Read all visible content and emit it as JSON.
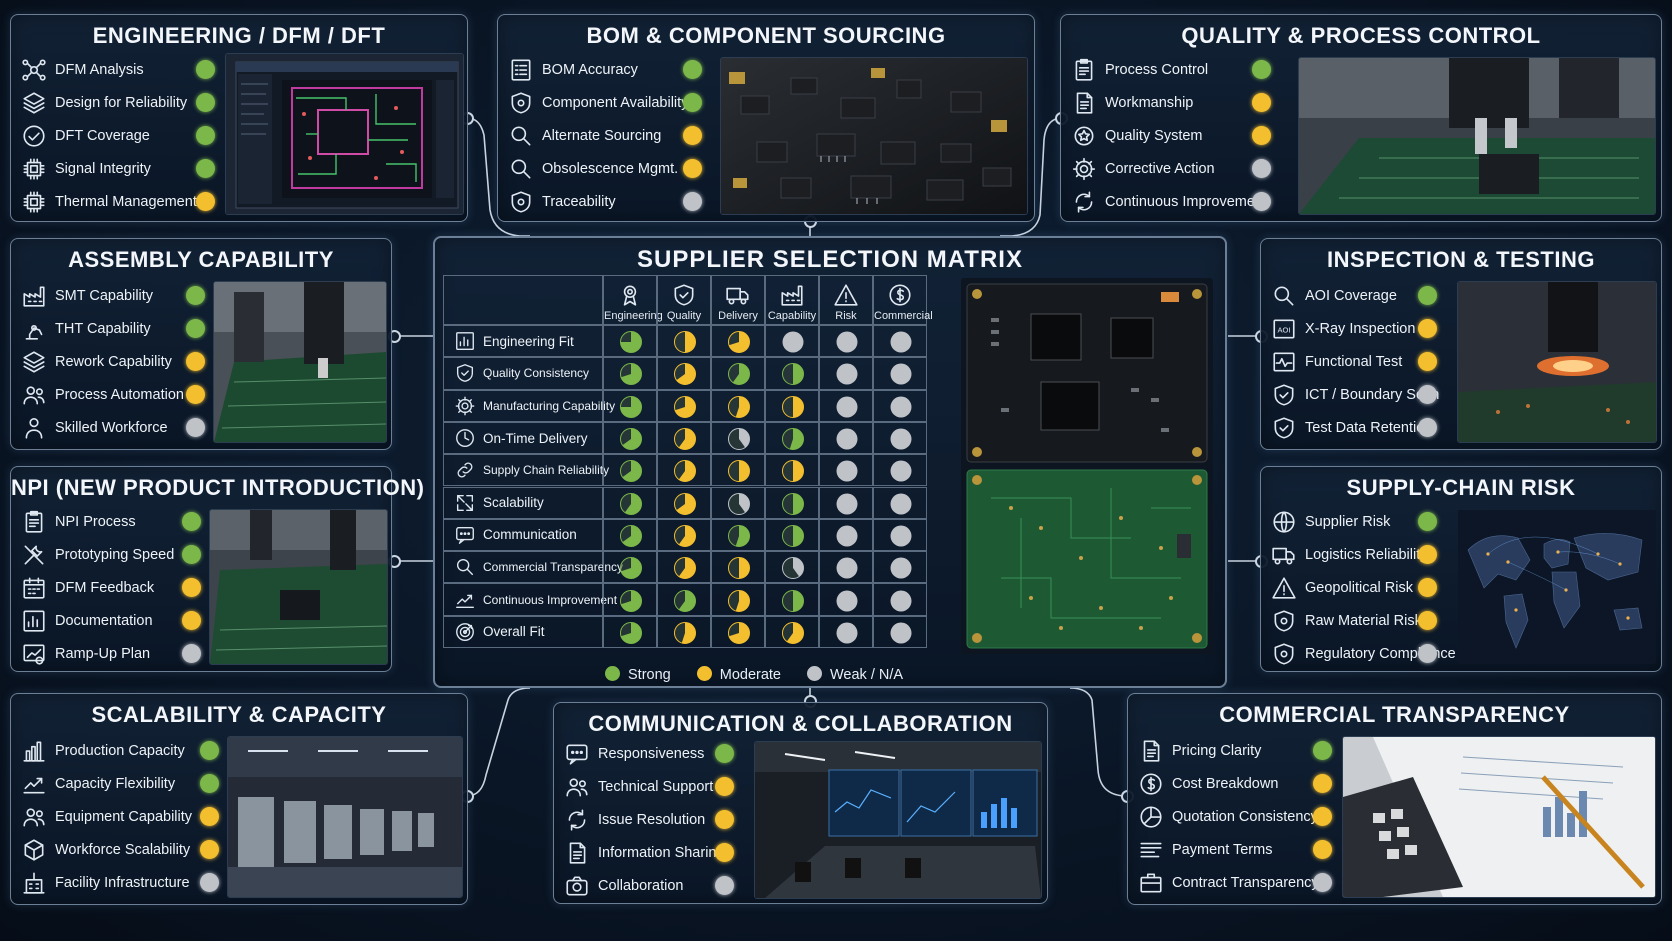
{
  "colors": {
    "strong": "#7cb74a",
    "moderate": "#f3bf2e",
    "weak": "#bfc3c8",
    "accent": "#8fd0ff"
  },
  "panels": {
    "engineering": {
      "title": "ENGINEERING / DFM / DFT",
      "items": [
        {
          "label": "DFM Analysis",
          "icon": "network-icon",
          "status": "strong"
        },
        {
          "label": "Design for Reliability",
          "icon": "layers-icon",
          "status": "strong"
        },
        {
          "label": "DFT Coverage",
          "icon": "check-circle-icon",
          "status": "strong"
        },
        {
          "label": "Signal Integrity",
          "icon": "chip-icon",
          "status": "strong"
        },
        {
          "label": "Thermal Management",
          "icon": "chip-icon",
          "status": "moderate"
        }
      ]
    },
    "bom": {
      "title": "BOM & COMPONENT SOURCING",
      "items": [
        {
          "label": "BOM Accuracy",
          "icon": "list-icon",
          "status": "strong"
        },
        {
          "label": "Component Availability",
          "icon": "shield-icon",
          "status": "strong"
        },
        {
          "label": "Alternate Sourcing",
          "icon": "search-icon",
          "status": "moderate"
        },
        {
          "label": "Obsolescence Mgmt.",
          "icon": "search-icon",
          "status": "moderate"
        },
        {
          "label": "Traceability",
          "icon": "shield-icon",
          "status": "weak"
        }
      ]
    },
    "quality": {
      "title": "QUALITY & PROCESS CONTROL",
      "items": [
        {
          "label": "Process Control",
          "icon": "clipboard-icon",
          "status": "strong"
        },
        {
          "label": "Workmanship",
          "icon": "document-icon",
          "status": "moderate"
        },
        {
          "label": "Quality System",
          "icon": "badge-icon",
          "status": "moderate"
        },
        {
          "label": "Corrective Action",
          "icon": "gear-icon",
          "status": "weak"
        },
        {
          "label": "Continuous Improvement",
          "icon": "cycle-icon",
          "status": "weak"
        }
      ]
    },
    "assembly": {
      "title": "ASSEMBLY CAPABILITY",
      "items": [
        {
          "label": "SMT Capability",
          "icon": "factory-icon",
          "status": "strong"
        },
        {
          "label": "THT Capability",
          "icon": "robot-arm-icon",
          "status": "strong"
        },
        {
          "label": "Rework Capability",
          "icon": "layers-icon",
          "status": "moderate"
        },
        {
          "label": "Process Automation",
          "icon": "users-icon",
          "status": "moderate"
        },
        {
          "label": "Skilled Workforce",
          "icon": "user-icon",
          "status": "weak"
        }
      ]
    },
    "inspection": {
      "title": "INSPECTION & TESTING",
      "items": [
        {
          "label": "AOI Coverage",
          "icon": "search-icon",
          "status": "strong"
        },
        {
          "label": "X-Ray Inspection",
          "icon": "aoi-icon",
          "status": "moderate"
        },
        {
          "label": "Functional Test",
          "icon": "pulse-icon",
          "status": "moderate"
        },
        {
          "label": "ICT / Boundary Scan",
          "icon": "shield-check-icon",
          "status": "weak"
        },
        {
          "label": "Test Data Retention",
          "icon": "shield-check-icon",
          "status": "weak"
        }
      ]
    },
    "npi": {
      "title": "NPI (NEW PRODUCT INTRODUCTION)",
      "items": [
        {
          "label": "NPI Process",
          "icon": "clipboard-icon",
          "status": "strong"
        },
        {
          "label": "Prototyping Speed",
          "icon": "tools-icon",
          "status": "strong"
        },
        {
          "label": "DFM Feedback",
          "icon": "calendar-icon",
          "status": "moderate"
        },
        {
          "label": "Documentation",
          "icon": "chart-doc-icon",
          "status": "moderate"
        },
        {
          "label": "Ramp-Up Plan",
          "icon": "ramp-icon",
          "status": "weak"
        }
      ]
    },
    "supplychain": {
      "title": "SUPPLY-CHAIN RISK",
      "items": [
        {
          "label": "Supplier Risk",
          "icon": "globe-icon",
          "status": "strong"
        },
        {
          "label": "Logistics Reliability",
          "icon": "truck-icon",
          "status": "moderate"
        },
        {
          "label": "Geopolitical Risk",
          "icon": "warning-icon",
          "status": "moderate"
        },
        {
          "label": "Raw Material Risk",
          "icon": "shield-icon",
          "status": "moderate"
        },
        {
          "label": "Regulatory Compliance",
          "icon": "shield-icon",
          "status": "weak"
        }
      ]
    },
    "scalability": {
      "title": "SCALABILITY & CAPACITY",
      "items": [
        {
          "label": "Production Capacity",
          "icon": "bar-chart-icon",
          "status": "strong"
        },
        {
          "label": "Capacity Flexibility",
          "icon": "trend-icon",
          "status": "strong"
        },
        {
          "label": "Equipment Capability",
          "icon": "users-icon",
          "status": "moderate"
        },
        {
          "label": "Workforce Scalability",
          "icon": "cube-icon",
          "status": "moderate"
        },
        {
          "label": "Facility Infrastructure",
          "icon": "building-icon",
          "status": "weak"
        }
      ]
    },
    "communication": {
      "title": "COMMUNICATION & COLLABORATION",
      "items": [
        {
          "label": "Responsiveness",
          "icon": "chat-icon",
          "status": "strong"
        },
        {
          "label": "Technical Support",
          "icon": "users-icon",
          "status": "moderate"
        },
        {
          "label": "Issue Resolution",
          "icon": "cycle-icon",
          "status": "moderate"
        },
        {
          "label": "Information Sharing",
          "icon": "document-icon",
          "status": "moderate"
        },
        {
          "label": "Collaboration",
          "icon": "camera-icon",
          "status": "weak"
        }
      ]
    },
    "commercial": {
      "title": "COMMERCIAL TRANSPARENCY",
      "items": [
        {
          "label": "Pricing Clarity",
          "icon": "document-icon",
          "status": "strong"
        },
        {
          "label": "Cost Breakdown",
          "icon": "dollar-icon",
          "status": "moderate"
        },
        {
          "label": "Quotation Consistency",
          "icon": "pie-icon",
          "status": "moderate"
        },
        {
          "label": "Payment Terms",
          "icon": "lines-icon",
          "status": "moderate"
        },
        {
          "label": "Contract Transparency",
          "icon": "briefcase-icon",
          "status": "weak"
        }
      ]
    }
  },
  "matrix": {
    "title": "SUPPLIER SELECTION MATRIX",
    "columns": [
      {
        "label": "Engineering",
        "icon": "award-icon"
      },
      {
        "label": "Quality",
        "icon": "shield-check-icon"
      },
      {
        "label": "Delivery",
        "icon": "truck-icon"
      },
      {
        "label": "Capability",
        "icon": "factory-icon"
      },
      {
        "label": "Risk",
        "icon": "warning-icon"
      },
      {
        "label": "Commercial",
        "icon": "dollar-icon"
      }
    ],
    "rows": [
      {
        "label": "Engineering Fit",
        "icon": "chart-doc-icon",
        "cells": [
          [
            "strong",
            0.75
          ],
          [
            "moderate",
            0.5
          ],
          [
            "moderate",
            0.7
          ],
          [
            "weak",
            0
          ],
          [
            "weak",
            0
          ],
          [
            "weak",
            0
          ]
        ]
      },
      {
        "label": "Quality Consistency",
        "icon": "shield-check-icon",
        "cells": [
          [
            "strong",
            0.7
          ],
          [
            "moderate",
            0.65
          ],
          [
            "strong",
            0.6
          ],
          [
            "strong",
            0.5
          ],
          [
            "weak",
            0
          ],
          [
            "weak",
            0
          ]
        ]
      },
      {
        "label": "Manufacturing Capability",
        "icon": "gear-icon",
        "cells": [
          [
            "strong",
            0.75
          ],
          [
            "moderate",
            0.7
          ],
          [
            "moderate",
            0.55
          ],
          [
            "moderate",
            0.5
          ],
          [
            "weak",
            0
          ],
          [
            "weak",
            0
          ]
        ]
      },
      {
        "label": "On-Time Delivery",
        "icon": "clock-icon",
        "cells": [
          [
            "strong",
            0.65
          ],
          [
            "moderate",
            0.6
          ],
          [
            "weak",
            0.4
          ],
          [
            "strong",
            0.55
          ],
          [
            "weak",
            0
          ],
          [
            "weak",
            0
          ]
        ]
      },
      {
        "label": "Supply Chain Reliability",
        "icon": "link-icon",
        "cells": [
          [
            "strong",
            0.65
          ],
          [
            "moderate",
            0.6
          ],
          [
            "moderate",
            0.5
          ],
          [
            "moderate",
            0.5
          ],
          [
            "weak",
            0
          ],
          [
            "weak",
            0
          ]
        ]
      },
      {
        "label": "Scalability",
        "icon": "expand-icon",
        "cells": [
          [
            "strong",
            0.6
          ],
          [
            "moderate",
            0.65
          ],
          [
            "weak",
            0.4
          ],
          [
            "strong",
            0.5
          ],
          [
            "weak",
            0
          ],
          [
            "weak",
            0
          ]
        ]
      },
      {
        "label": "Communication",
        "icon": "chat-icon",
        "cells": [
          [
            "strong",
            0.65
          ],
          [
            "moderate",
            0.6
          ],
          [
            "strong",
            0.55
          ],
          [
            "strong",
            0.5
          ],
          [
            "weak",
            0
          ],
          [
            "weak",
            0
          ]
        ]
      },
      {
        "label": "Commercial Transparency",
        "icon": "search-icon",
        "cells": [
          [
            "strong",
            0.7
          ],
          [
            "moderate",
            0.6
          ],
          [
            "moderate",
            0.5
          ],
          [
            "weak",
            0.4
          ],
          [
            "weak",
            0
          ],
          [
            "weak",
            0
          ]
        ]
      },
      {
        "label": "Continuous Improvement",
        "icon": "trend-icon",
        "cells": [
          [
            "strong",
            0.7
          ],
          [
            "strong",
            0.6
          ],
          [
            "moderate",
            0.55
          ],
          [
            "strong",
            0.5
          ],
          [
            "weak",
            0
          ],
          [
            "weak",
            0
          ]
        ]
      },
      {
        "label": "Overall Fit",
        "icon": "target-icon",
        "cells": [
          [
            "strong",
            0.7
          ],
          [
            "moderate",
            0.55
          ],
          [
            "moderate",
            0.7
          ],
          [
            "moderate",
            0.6
          ],
          [
            "weak",
            0
          ],
          [
            "weak",
            0
          ]
        ]
      }
    ]
  },
  "legend": [
    {
      "label": "Strong",
      "status": "strong"
    },
    {
      "label": "Moderate",
      "status": "moderate"
    },
    {
      "label": "Weak / N/A",
      "status": "weak"
    }
  ]
}
